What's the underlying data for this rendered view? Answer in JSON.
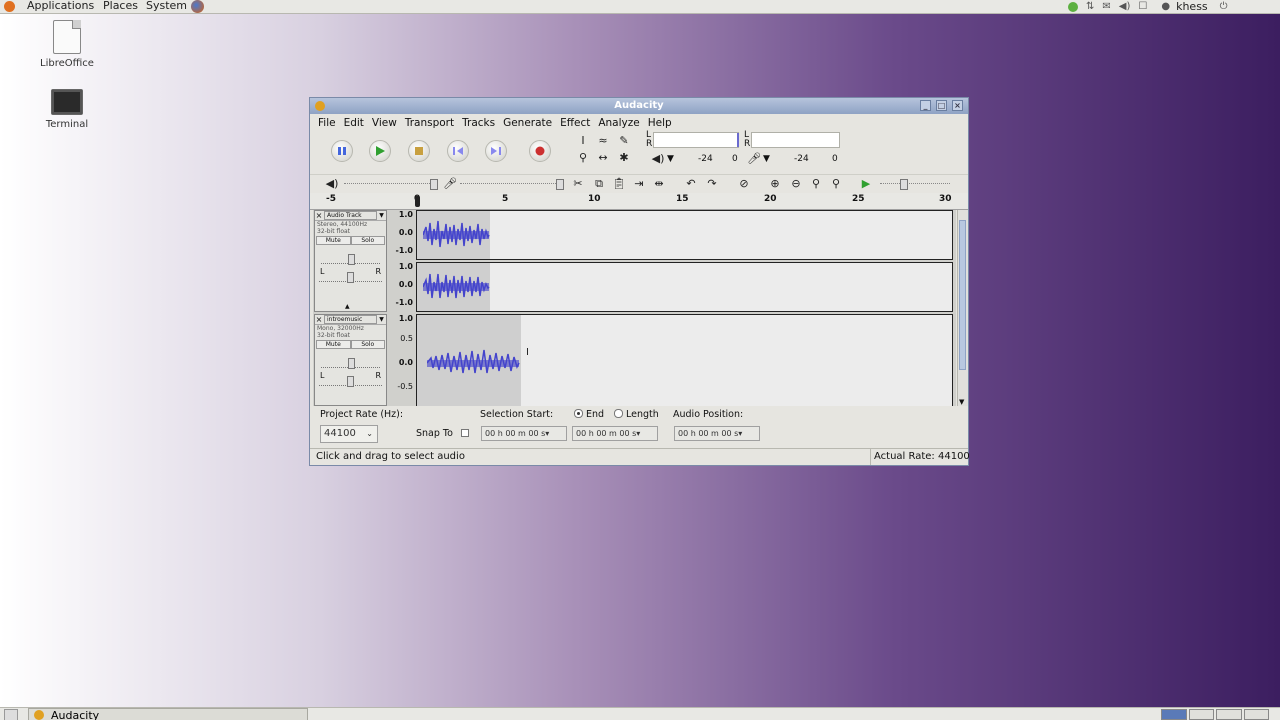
{
  "top_panel": {
    "menus": [
      "Applications",
      "Places",
      "System"
    ],
    "username": "khess"
  },
  "desktop": {
    "icons": [
      {
        "label": "LibreOffice",
        "icon": "document-icon"
      },
      {
        "label": "Terminal",
        "icon": "terminal-icon"
      }
    ]
  },
  "taskbar": {
    "window_label": "Audacity"
  },
  "window": {
    "title": "Audacity",
    "menu": [
      "File",
      "Edit",
      "View",
      "Transport",
      "Tracks",
      "Generate",
      "Effect",
      "Analyze",
      "Help"
    ],
    "meters": {
      "left_label": "L",
      "right_label": "R",
      "play_scale": [
        "-24",
        "0"
      ],
      "rec_scale": [
        "-24",
        "0"
      ]
    },
    "ruler_ticks": [
      "-5",
      "0",
      "5",
      "10",
      "15",
      "20",
      "25",
      "30"
    ],
    "tracks": [
      {
        "name": "Audio Track",
        "info": [
          "Stereo, 44100Hz",
          "32-bit float"
        ],
        "mute": "Mute",
        "solo": "Solo",
        "pan_left": "L",
        "pan_right": "R",
        "channels": [
          {
            "scale": [
              "1.0",
              "0.0",
              "-1.0"
            ]
          },
          {
            "scale": [
              "1.0",
              "0.0",
              "-1.0"
            ]
          }
        ]
      },
      {
        "name": "introemusic",
        "info": [
          "Mono, 32000Hz",
          "32-bit float"
        ],
        "mute": "Mute",
        "solo": "Solo",
        "pan_left": "L",
        "pan_right": "R",
        "channels": [
          {
            "scale": [
              "1.0",
              "0.5",
              "0.0",
              "-0.5"
            ]
          }
        ]
      }
    ],
    "selection_bar": {
      "project_rate_label": "Project Rate (Hz):",
      "project_rate": "44100",
      "snap_to_label": "Snap To",
      "selection_start_label": "Selection Start:",
      "end_label": "End",
      "length_label": "Length",
      "audio_position_label": "Audio Position:",
      "time_value": "00 h 00 m 00 s"
    },
    "status": {
      "message": "Click and drag to select audio",
      "actual_rate": "Actual Rate: 44100"
    }
  },
  "colors": {
    "waveform": "#4444cc",
    "title_bar": "#9aaccb"
  }
}
